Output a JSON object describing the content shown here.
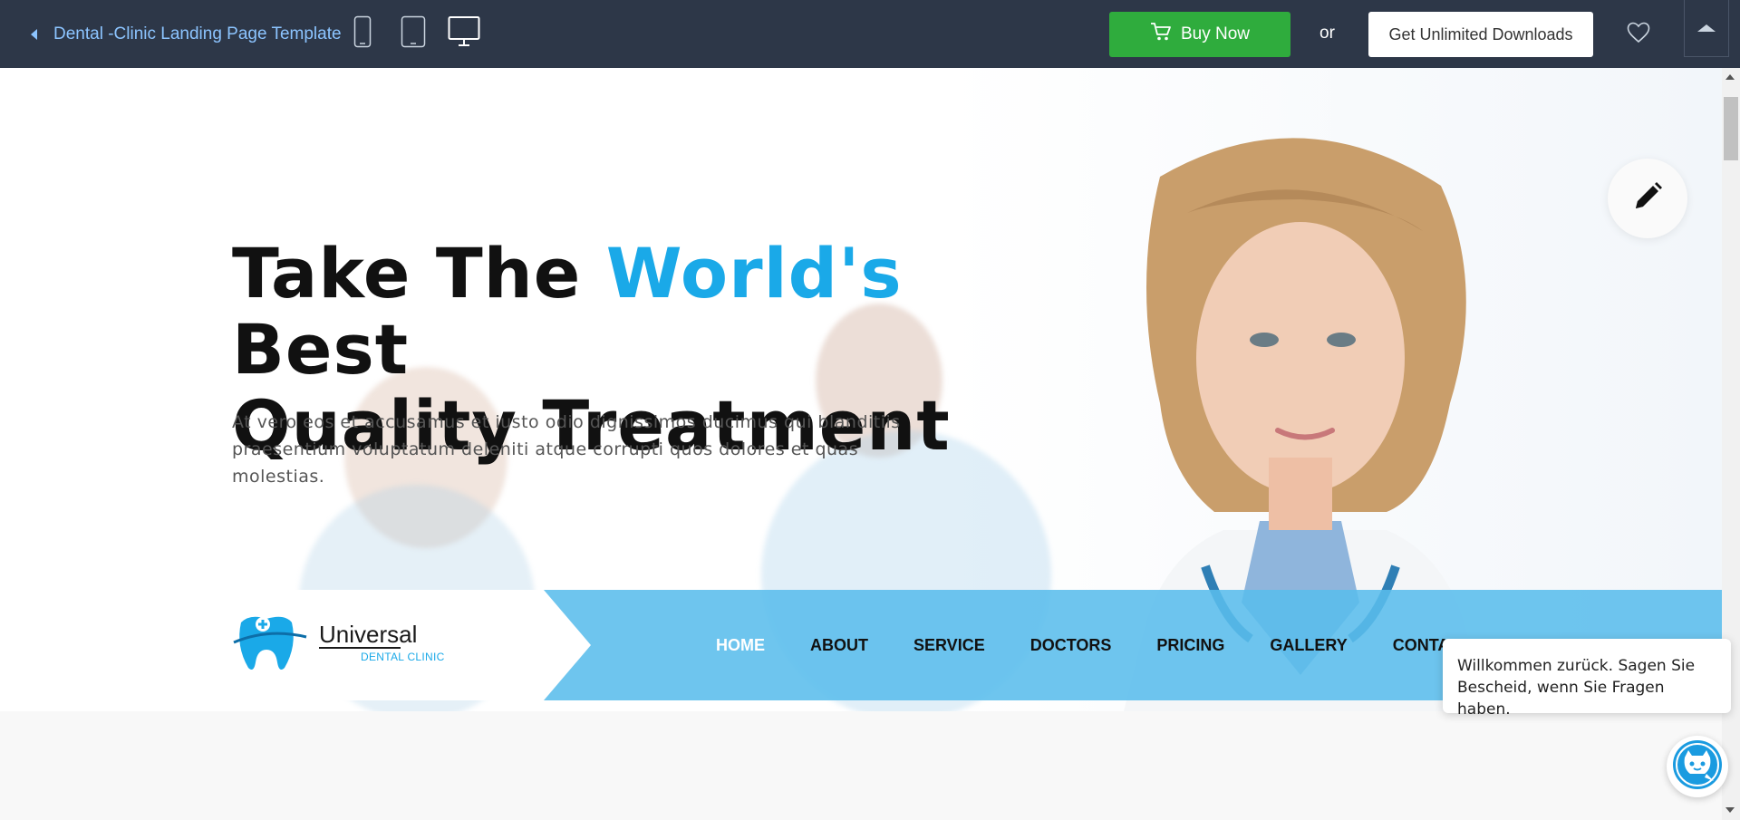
{
  "topbar": {
    "back_label": "Dental -Clinic Landing Page Template",
    "buy_label": "Buy Now",
    "or_label": "or",
    "unlimited_label": "Get Unlimited Downloads"
  },
  "hero": {
    "title_part1": "Take The ",
    "title_highlight": "World's",
    "title_part2": " Best",
    "title_line2": "Quality Treatment",
    "description": "At vero eos et accusamus et iusto odio dignissimos ducimus qui blanditiis praesentium voluptatum deleniti atque corrupti quos dolores et quas molestias."
  },
  "logo": {
    "name": "Universal",
    "subtitle": "DENTAL CLINIC"
  },
  "nav": {
    "items": [
      {
        "label": "HOME"
      },
      {
        "label": "ABOUT"
      },
      {
        "label": "SERVICE"
      },
      {
        "label": "DOCTORS"
      },
      {
        "label": "PRICING"
      },
      {
        "label": "GALLERY"
      },
      {
        "label": "CONTA"
      }
    ]
  },
  "chat": {
    "message": "Willkommen zurück. Sagen Sie Bescheid, wenn Sie Fragen haben."
  },
  "colors": {
    "topbar": "#2d3748",
    "buy_green": "#2fac3d",
    "accent_blue": "#1aa9e8",
    "nav_blue": "#5abdec"
  },
  "icons": [
    "caret-left-icon",
    "phone-device-icon",
    "tablet-device-icon",
    "desktop-device-icon",
    "cart-icon",
    "heart-icon",
    "caret-up-icon",
    "pencil-icon",
    "tooth-logo-icon",
    "chat-bot-icon"
  ]
}
